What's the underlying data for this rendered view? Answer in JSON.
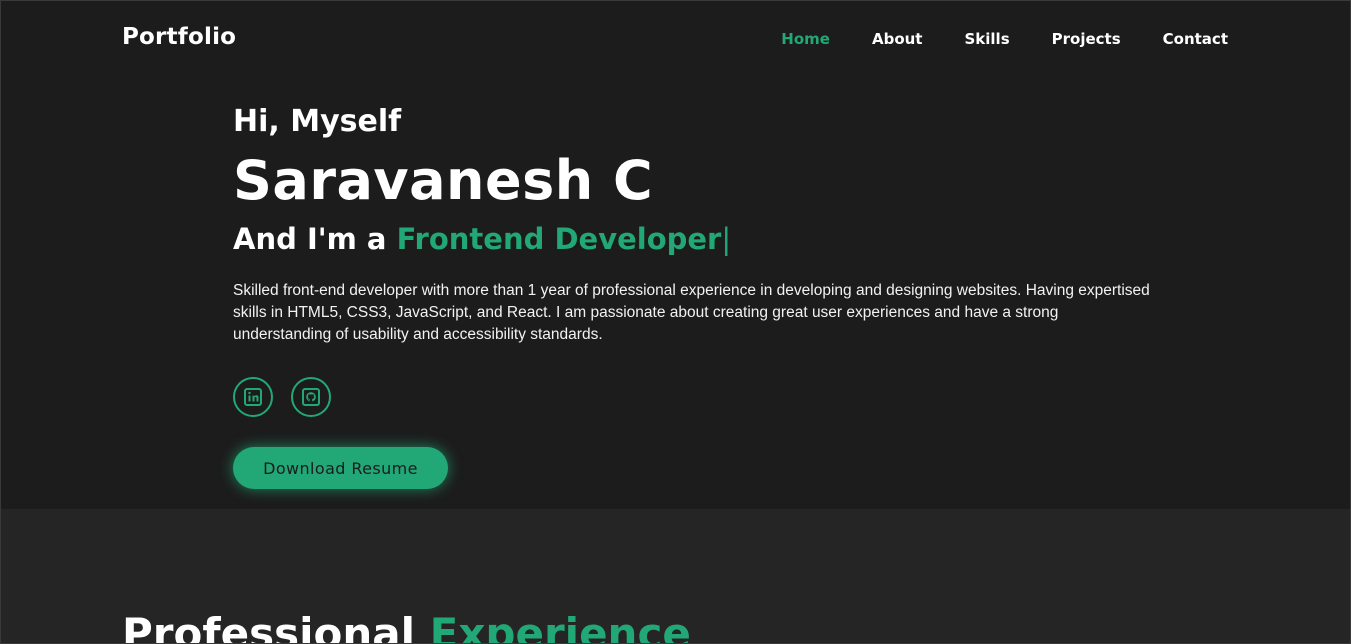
{
  "header": {
    "logo": "Portfolio",
    "nav": [
      {
        "label": "Home",
        "active": true
      },
      {
        "label": "About",
        "active": false
      },
      {
        "label": "Skills",
        "active": false
      },
      {
        "label": "Projects",
        "active": false
      },
      {
        "label": "Contact",
        "active": false
      }
    ]
  },
  "hero": {
    "greeting": "Hi, Myself",
    "name": "Saravanesh C",
    "role_prefix": "And I'm a ",
    "role": "Frontend Developer",
    "cursor": "|",
    "bio": "Skilled front-end developer with more than 1 year of professional experience in developing and designing websites. Having expertised skills in HTML5, CSS3, JavaScript, and React. I am passionate about creating great user experiences and have a strong understanding of usability and accessibility standards.",
    "socials": [
      {
        "icon": "linkedin-icon"
      },
      {
        "icon": "github-icon"
      }
    ],
    "download_label": "Download Resume"
  },
  "experience": {
    "title_prefix": "Professional ",
    "title_accent": "Experience"
  },
  "colors": {
    "accent": "#22a876",
    "background": "#1c1c1c",
    "section_background": "#252525",
    "text": "#ffffff"
  }
}
